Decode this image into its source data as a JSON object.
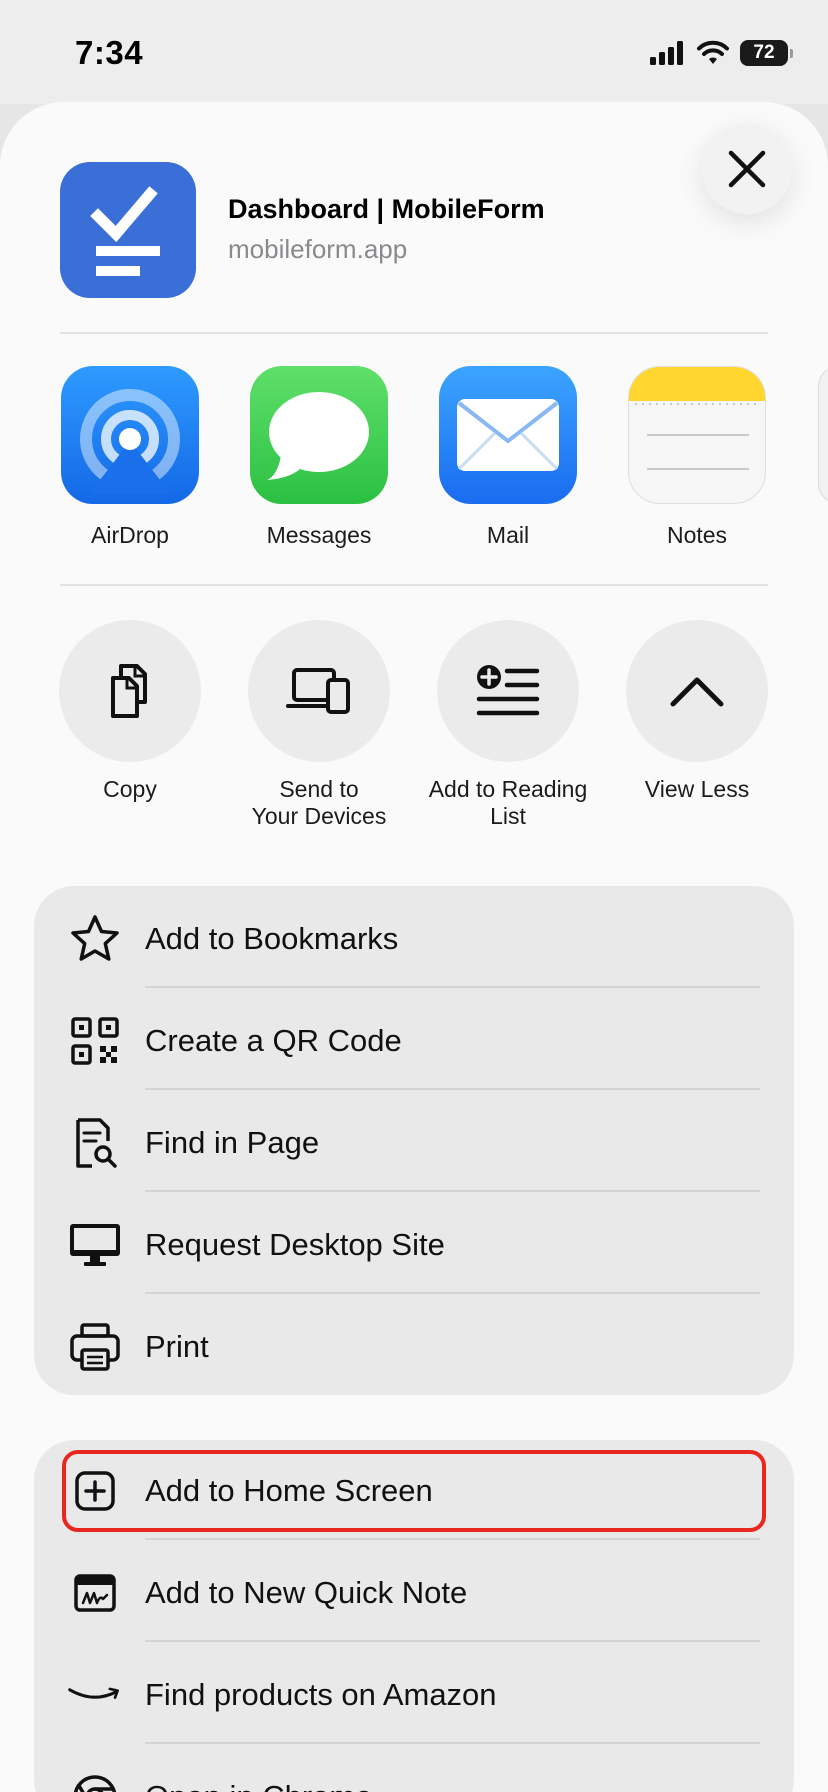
{
  "status": {
    "time": "7:34",
    "battery": "72"
  },
  "share_header": {
    "title": "Dashboard | MobileForm",
    "url": "mobileform.app"
  },
  "apps": [
    {
      "label": "AirDrop",
      "icon": "airdrop-icon"
    },
    {
      "label": "Messages",
      "icon": "messages-icon"
    },
    {
      "label": "Mail",
      "icon": "mail-icon"
    },
    {
      "label": "Notes",
      "icon": "notes-icon"
    }
  ],
  "actions": [
    {
      "label": "Copy",
      "icon": "copy-icon"
    },
    {
      "label": "Send to\nYour Devices",
      "icon": "devices-icon"
    },
    {
      "label": "Add to Reading\nList",
      "icon": "reading-list-icon"
    },
    {
      "label": "View Less",
      "icon": "chevron-up-icon"
    }
  ],
  "menu_group_1": [
    {
      "label": "Add to Bookmarks",
      "icon": "star-icon"
    },
    {
      "label": "Create a QR Code",
      "icon": "qr-code-icon"
    },
    {
      "label": "Find in Page",
      "icon": "find-in-page-icon"
    },
    {
      "label": "Request Desktop Site",
      "icon": "desktop-icon"
    },
    {
      "label": "Print",
      "icon": "printer-icon"
    }
  ],
  "menu_group_2": [
    {
      "label": "Add to Home Screen",
      "icon": "plus-square-icon"
    },
    {
      "label": "Add to New Quick Note",
      "icon": "quick-note-icon"
    },
    {
      "label": "Find products on Amazon",
      "icon": "amazon-icon"
    },
    {
      "label": "Open in Chrome",
      "icon": "chrome-icon"
    }
  ],
  "colors": {
    "highlight": "#e8281e",
    "brand": "#3a6fd8"
  }
}
